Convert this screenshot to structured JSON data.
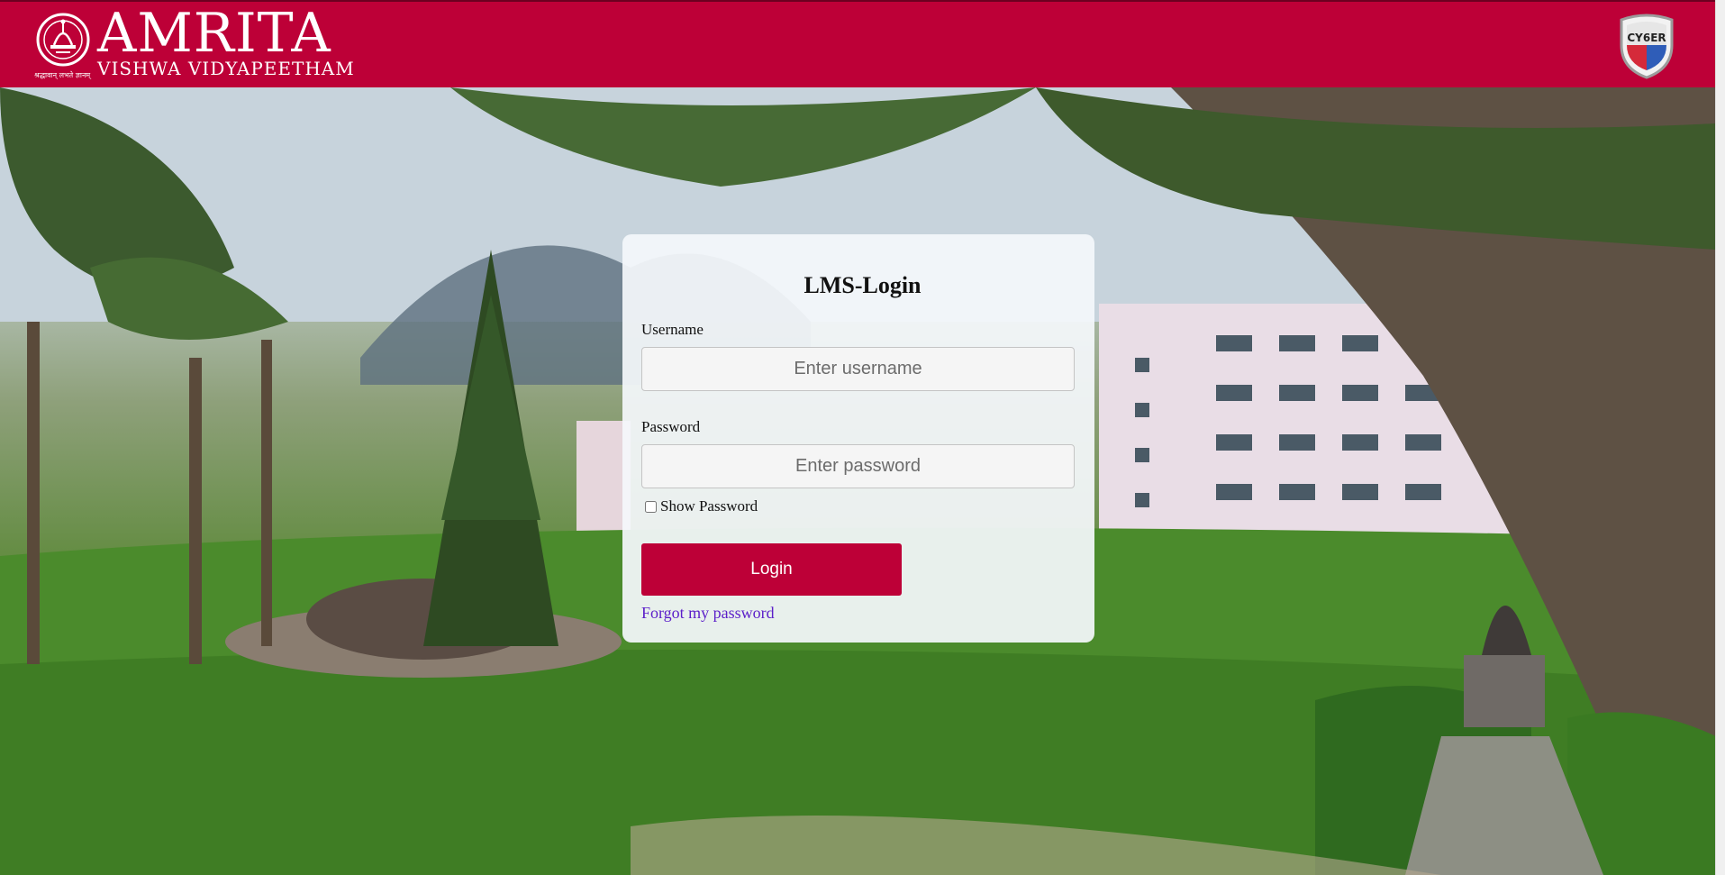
{
  "header": {
    "logo_main": "AMRITA",
    "logo_sub": "VISHWA VIDYAPEETHAM",
    "logo_motto": "श्रद्धावान् लभते ज्ञानम्",
    "badge_text": "CY6ER",
    "brand_color": "#bd0037"
  },
  "login": {
    "title": "LMS-Login",
    "username_label": "Username",
    "username_placeholder": "Enter username",
    "password_label": "Password",
    "password_placeholder": "Enter password",
    "show_password_label": "Show Password",
    "login_button": "Login",
    "forgot_link": "Forgot my password",
    "link_color": "#5b1ec9"
  }
}
